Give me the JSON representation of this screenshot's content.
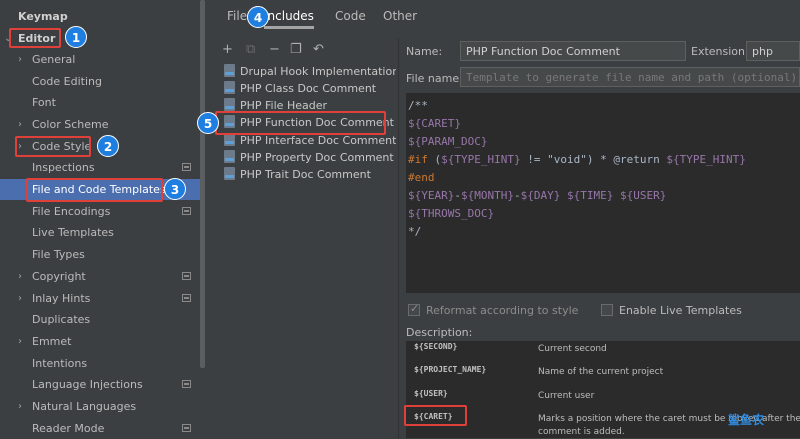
{
  "sidebar": {
    "items": [
      {
        "label": "Keymap",
        "bold": true,
        "arrow": false,
        "indent": 0
      },
      {
        "label": "Editor",
        "bold": true,
        "arrow": "open",
        "indent": 0
      },
      {
        "label": "General",
        "arrow": "closed",
        "indent": 1
      },
      {
        "label": "Code Editing",
        "arrow": false,
        "indent": 1
      },
      {
        "label": "Font",
        "arrow": false,
        "indent": 1
      },
      {
        "label": "Color Scheme",
        "arrow": "closed",
        "indent": 1
      },
      {
        "label": "Code Style",
        "arrow": "closed",
        "indent": 1
      },
      {
        "label": "Inspections",
        "arrow": false,
        "indent": 1,
        "mini": true
      },
      {
        "label": "File and Code Templates",
        "arrow": false,
        "indent": 1,
        "selected": true
      },
      {
        "label": "File Encodings",
        "arrow": false,
        "indent": 1,
        "mini": true
      },
      {
        "label": "Live Templates",
        "arrow": false,
        "indent": 1
      },
      {
        "label": "File Types",
        "arrow": false,
        "indent": 1
      },
      {
        "label": "Copyright",
        "arrow": "closed",
        "indent": 1,
        "mini": true
      },
      {
        "label": "Inlay Hints",
        "arrow": "closed",
        "indent": 1,
        "mini": true
      },
      {
        "label": "Duplicates",
        "arrow": false,
        "indent": 1
      },
      {
        "label": "Emmet",
        "arrow": "closed",
        "indent": 1
      },
      {
        "label": "Intentions",
        "arrow": false,
        "indent": 1
      },
      {
        "label": "Language Injections",
        "arrow": false,
        "indent": 1,
        "mini": true
      },
      {
        "label": "Natural Languages",
        "arrow": "closed",
        "indent": 1
      },
      {
        "label": "Reader Mode",
        "arrow": false,
        "indent": 1,
        "mini": true
      }
    ]
  },
  "tabs": [
    {
      "label": "Files",
      "active": false
    },
    {
      "label": "Includes",
      "active": true
    },
    {
      "label": "Code",
      "active": false
    },
    {
      "label": "Other",
      "active": false
    }
  ],
  "toolbar": {
    "add": "+",
    "copy_disabled": "⧉",
    "remove": "−",
    "duplicate": "❐",
    "reset": "↶"
  },
  "templates": [
    "Drupal Hook Implementation Doc Comment",
    "PHP Class Doc Comment",
    "PHP File Header",
    "PHP Function Doc Comment",
    "PHP Interface Doc Comment",
    "PHP Property Doc Comment",
    "PHP Trait Doc Comment"
  ],
  "selected_template": "PHP Function Doc Comment",
  "form": {
    "name_label": "Name:",
    "name_value": "PHP Function Doc Comment",
    "extension_label": "Extension:",
    "extension_value": "php",
    "filename_label": "File name:",
    "filename_placeholder": "Template to generate file name and path (optional)"
  },
  "code_lines": [
    [
      {
        "t": "/**",
        "c": "c-comment"
      }
    ],
    [
      {
        "t": "${CARET}",
        "c": "c-var"
      }
    ],
    [
      {
        "t": "${PARAM_DOC}",
        "c": "c-var"
      }
    ],
    [
      {
        "t": "#if",
        "c": "c-dir"
      },
      {
        "t": " (",
        "c": "c-plain"
      },
      {
        "t": "${TYPE_HINT}",
        "c": "c-var"
      },
      {
        "t": " != ",
        "c": "c-plain"
      },
      {
        "t": "\"void\"",
        "c": "c-plain"
      },
      {
        "t": ") * @return ",
        "c": "c-plain"
      },
      {
        "t": "${TYPE_HINT}",
        "c": "c-var"
      }
    ],
    [
      {
        "t": "#end",
        "c": "c-dir"
      }
    ],
    [
      {
        "t": "${YEAR}",
        "c": "c-var"
      },
      {
        "t": "-",
        "c": "c-plain"
      },
      {
        "t": "${MONTH}",
        "c": "c-var"
      },
      {
        "t": "-",
        "c": "c-plain"
      },
      {
        "t": "${DAY}",
        "c": "c-var"
      },
      {
        "t": " ",
        "c": "c-plain"
      },
      {
        "t": "${TIME}",
        "c": "c-var"
      },
      {
        "t": " ",
        "c": "c-plain"
      },
      {
        "t": "${USER}",
        "c": "c-var"
      }
    ],
    [
      {
        "t": "${THROWS_DOC}",
        "c": "c-var"
      }
    ],
    [
      {
        "t": "*/",
        "c": "c-comment"
      }
    ]
  ],
  "options": {
    "reformat_label": "Reformat according to style",
    "reformat_checked": true,
    "live_templates_label": "Enable Live Templates",
    "live_templates_checked": false
  },
  "description": {
    "label": "Description:",
    "rows": [
      {
        "key": "${SECOND}",
        "value": "Current second"
      },
      {
        "key": "${PROJECT_NAME}",
        "value": "Name of the current project"
      },
      {
        "key": "${USER}",
        "value": "Current user"
      },
      {
        "key": "${CARET}",
        "value": "Marks a position where the caret must be moved after the"
      },
      {
        "key": "",
        "value": "comment is added."
      }
    ]
  },
  "annotations": [
    "1",
    "2",
    "3",
    "4",
    "5"
  ],
  "watermark": "鲨鱼农"
}
